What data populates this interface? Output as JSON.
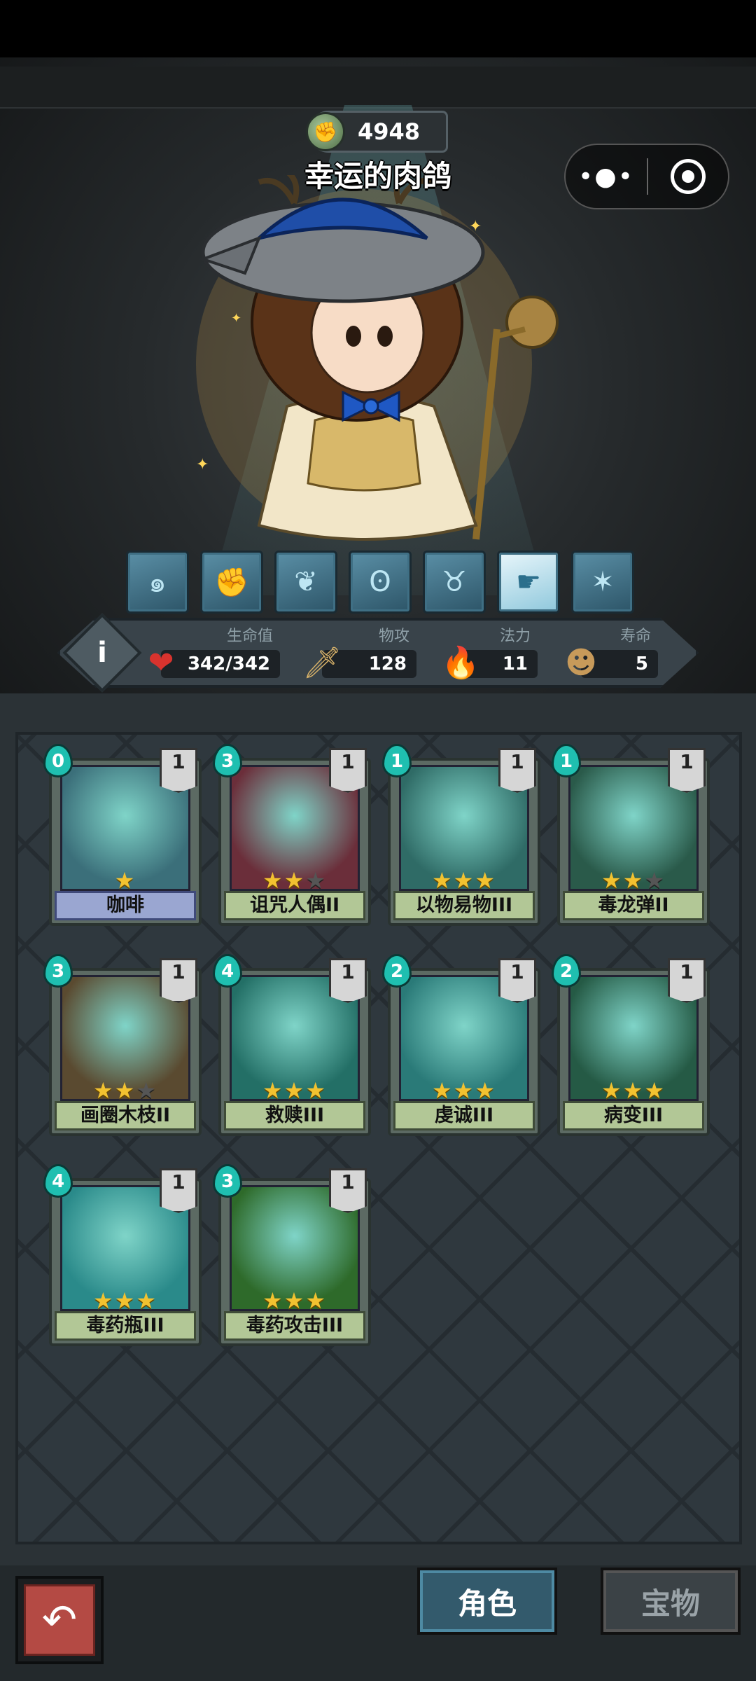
{
  "header": {
    "currency_icon": "green-fist-coin-icon",
    "currency_value": "4948",
    "character_name": "幸运的肉鸽"
  },
  "capsule": {
    "more_icon": "more-dots-icon",
    "close_icon": "target-close-icon"
  },
  "skills": [
    {
      "icon": "swirl-icon",
      "active": false
    },
    {
      "icon": "fist-icon",
      "active": false
    },
    {
      "icon": "leaf-icon",
      "active": false
    },
    {
      "icon": "spiral-icon",
      "active": false
    },
    {
      "icon": "muscle-icon",
      "active": false
    },
    {
      "icon": "pointing-hand-icon",
      "active": true
    },
    {
      "icon": "claw-icon",
      "active": false
    }
  ],
  "stats": {
    "hp_label": "生命值",
    "hp_value": "342/342",
    "atk_label": "物攻",
    "atk_value": "128",
    "mp_label": "法力",
    "mp_value": "11",
    "life_label": "寿命",
    "life_value": "5"
  },
  "cards": [
    {
      "name": "咖啡",
      "cost": "0",
      "level": "1",
      "stars": 1,
      "max_stars": 1,
      "color": "#3b6f7a"
    },
    {
      "name": "诅咒人偶II",
      "cost": "3",
      "level": "1",
      "stars": 2,
      "max_stars": 3,
      "color": "#6b2e3a"
    },
    {
      "name": "以物易物III",
      "cost": "1",
      "level": "1",
      "stars": 3,
      "max_stars": 3,
      "color": "#2f6b66"
    },
    {
      "name": "毒龙弹II",
      "cost": "1",
      "level": "1",
      "stars": 2,
      "max_stars": 3,
      "color": "#2a5a4a"
    },
    {
      "name": "画圈木枝II",
      "cost": "3",
      "level": "1",
      "stars": 2,
      "max_stars": 3,
      "color": "#5a4a30"
    },
    {
      "name": "救赎III",
      "cost": "4",
      "level": "1",
      "stars": 3,
      "max_stars": 3,
      "color": "#236f66"
    },
    {
      "name": "虔诚III",
      "cost": "2",
      "level": "1",
      "stars": 3,
      "max_stars": 3,
      "color": "#2a7a78"
    },
    {
      "name": "病变III",
      "cost": "2",
      "level": "1",
      "stars": 3,
      "max_stars": 3,
      "color": "#255a45"
    },
    {
      "name": "毒药瓶III",
      "cost": "4",
      "level": "1",
      "stars": 3,
      "max_stars": 3,
      "color": "#2a8a8a"
    },
    {
      "name": "毒药攻击III",
      "cost": "3",
      "level": "1",
      "stars": 3,
      "max_stars": 3,
      "color": "#2e6a2a"
    }
  ],
  "bottom": {
    "back_icon": "return-arrow-icon",
    "tab_role": "角色",
    "tab_treasure": "宝物"
  }
}
